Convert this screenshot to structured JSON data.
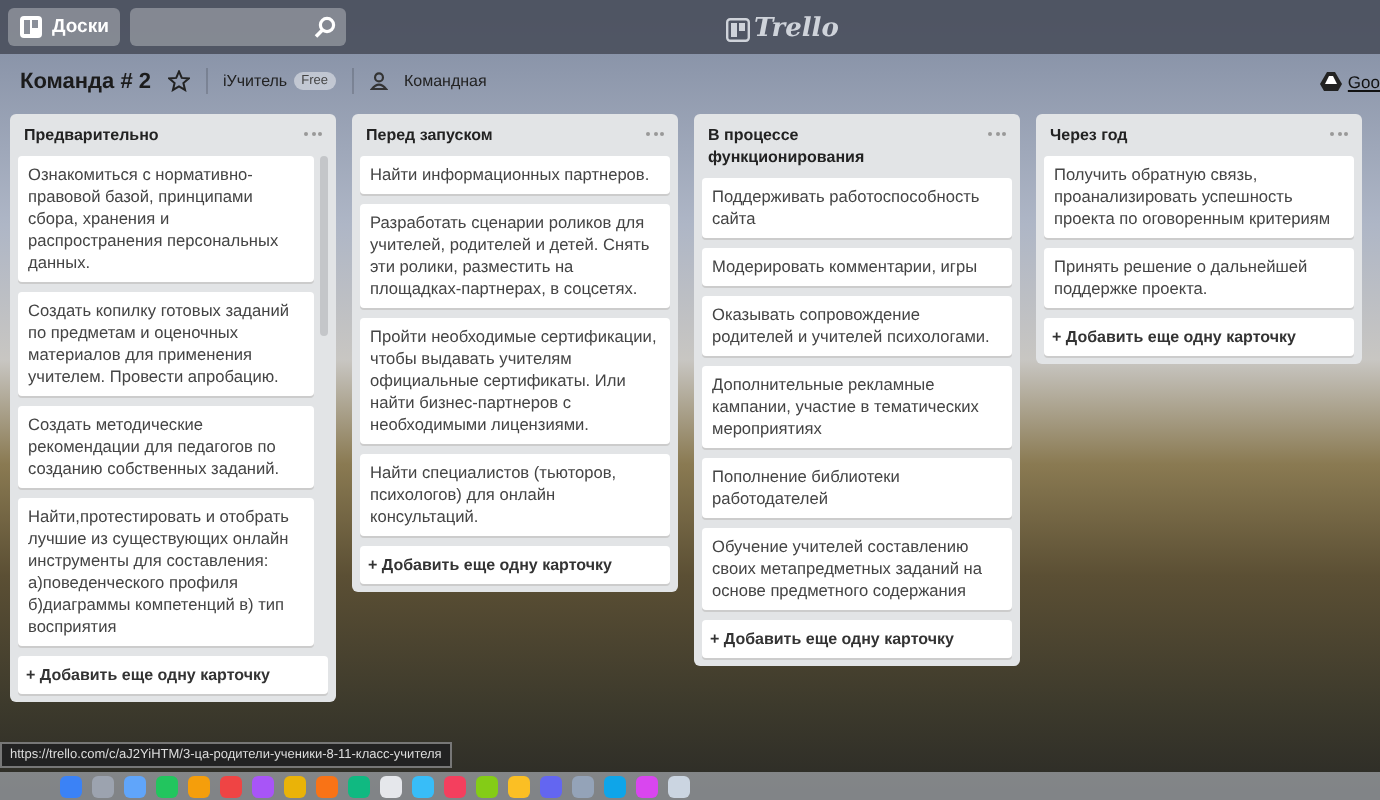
{
  "header": {
    "boards_button": "Доски",
    "logo": "Trello"
  },
  "board": {
    "title": "Команда # 2",
    "starred": false,
    "team": "iУчитель",
    "plan_badge": "Free",
    "visibility": "Командная",
    "right_link": "Goo"
  },
  "lists": [
    {
      "title": "Предварительно",
      "scrollbar": true,
      "cards": [
        "Ознакомиться с нормативно-правовой базой, принципами сбора, хранения и распространения персональных данных.",
        "Создать копилку готовых заданий по предметам и оценочных материалов для применения учителем. Провести апробацию.",
        "Создать методические рекомендации для педагогов по созданию собственных заданий.",
        "Найти,протестировать и отобрать лучшие из существующих онлайн инструменты для составления: а)поведенческого профиля б)диаграммы компетенций в) тип восприятия"
      ],
      "add_card": "+ Добавить еще одну карточку"
    },
    {
      "title": "Перед запуском",
      "scrollbar": false,
      "cards": [
        "Найти информационных партнеров.",
        "Разработать сценарии роликов для учителей, родителей и детей. Снять эти ролики, разместить на площадках-партнерах, в соцсетях.",
        "Пройти необходимые сертификации, чтобы выдавать учителям официальные сертификаты. Или найти бизнес-партнеров с необходимыми лицензиями.",
        "Найти специалистов (тьюторов, психологов) для онлайн консультаций."
      ],
      "add_card": "+ Добавить еще одну карточку"
    },
    {
      "title": "В процессе функционирования",
      "scrollbar": false,
      "cards": [
        "Поддерживать работоспособность сайта",
        "Модерировать комментарии, игры",
        "Оказывать сопровождение родителей и учителей психологами.",
        "Дополнительные рекламные кампании, участие в тематических мероприятиях",
        "Пополнение библиотеки работодателей",
        "Обучение учителей составлению своих метапредметных заданий на основе предметного содержания"
      ],
      "add_card": "+ Добавить еще одну карточку"
    },
    {
      "title": "Через год",
      "scrollbar": false,
      "cards": [
        "Получить обратную связь, проанализировать успешность проекта по оговоренным критериям",
        "Принять решение о дальнейшей поддержке проекта."
      ],
      "add_card": "+ Добавить еще одну карточку"
    }
  ],
  "status_url": "https://trello.com/c/aJ2YiHTM/3-ца-родители-ученики-8-11-класс-учителя"
}
